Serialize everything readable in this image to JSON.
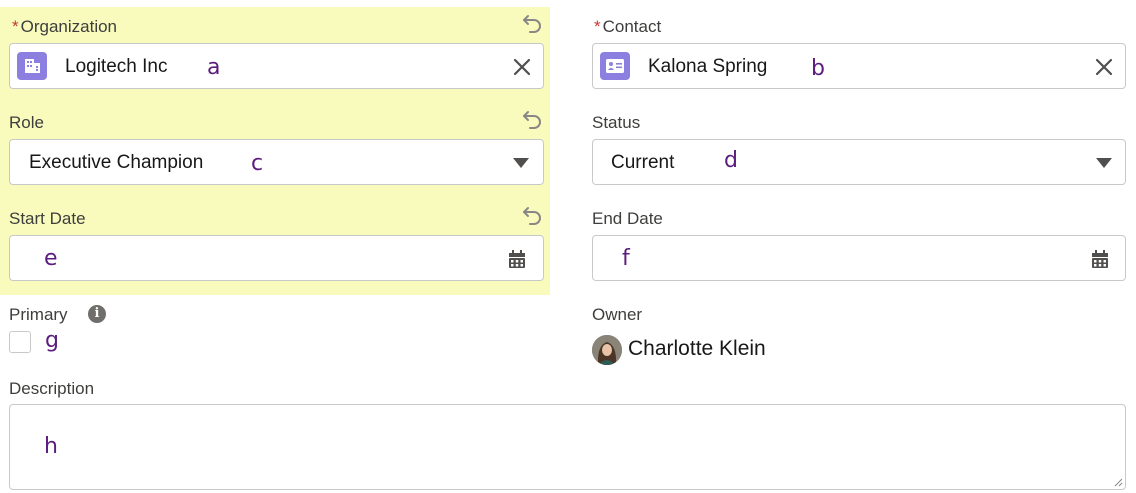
{
  "organization": {
    "label": "Organization",
    "required_mark": "*",
    "value": "Logitech Inc",
    "marker": "a",
    "icon": "building-icon"
  },
  "contact": {
    "label": "Contact",
    "required_mark": "*",
    "value": "Kalona Spring",
    "marker": "b",
    "icon": "contact-card-icon"
  },
  "role": {
    "label": "Role",
    "value": "Executive Champion",
    "marker": "c"
  },
  "status": {
    "label": "Status",
    "value": "Current",
    "marker": "d"
  },
  "start_date": {
    "label": "Start Date",
    "value": "",
    "marker": "e"
  },
  "end_date": {
    "label": "End Date",
    "value": "",
    "marker": "f"
  },
  "primary": {
    "label": "Primary",
    "info_glyph": "i",
    "checked": false,
    "marker": "g"
  },
  "owner": {
    "label": "Owner",
    "name": "Charlotte Klein"
  },
  "description": {
    "label": "Description",
    "value": "",
    "marker": "h"
  },
  "colors": {
    "highlight": "#f9fbbd",
    "required": "#c23934",
    "object_icon": "#8b7fe0",
    "marker_text": "#5b1d7e"
  }
}
